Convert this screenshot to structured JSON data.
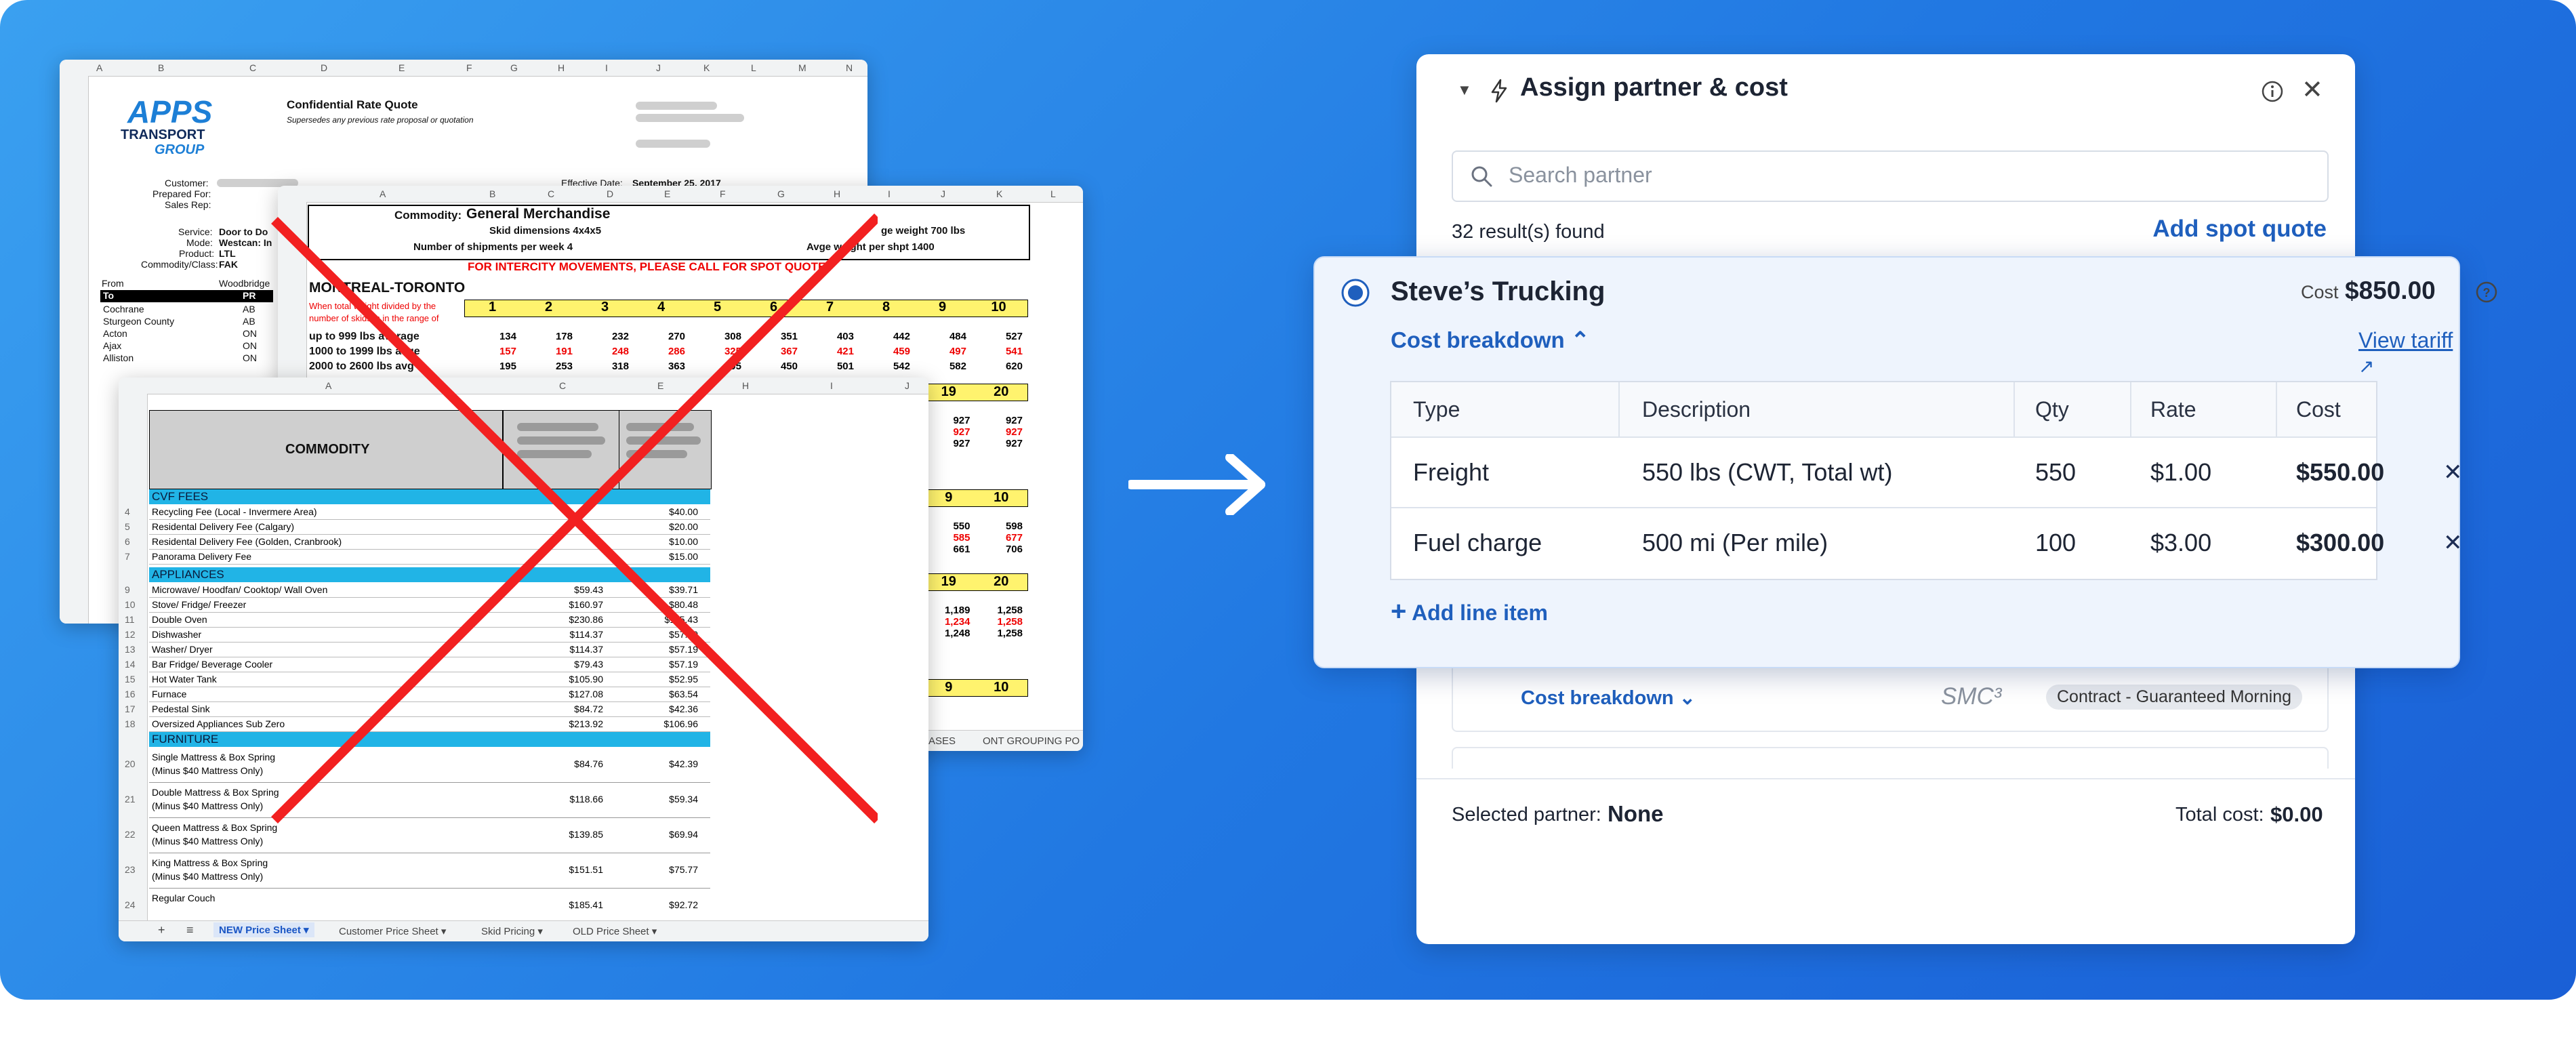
{
  "colors": {
    "accent": "#1f5fbd",
    "bg_blue": "#2178e2",
    "red_x": "#f22020"
  },
  "back_sheet": {
    "columns": [
      "A",
      "B",
      "C",
      "D",
      "E",
      "F",
      "G",
      "H",
      "I",
      "J",
      "K",
      "L",
      "M",
      "N"
    ],
    "logo": [
      "APPS",
      "TRANSPORT",
      "GROUP"
    ],
    "title": "Confidential Rate Quote",
    "subtitle": "Supersedes any previous rate proposal or quotation",
    "labels": [
      "Customer:",
      "Prepared For:",
      "Sales Rep:",
      "Service:",
      "Mode:",
      "Product:",
      "Commodity/Class:",
      "From"
    ],
    "values": [
      "Door to Do",
      "Westcan: In",
      "LTL",
      "FAK",
      "Woodbridge"
    ],
    "effective_label": "Effective Date:",
    "effective_value": "September 25, 2017",
    "to_header": "To",
    "pr_header": "PR",
    "cities": [
      "Cochrane",
      "Sturgeon County",
      "Acton",
      "Ajax",
      "Alliston"
    ],
    "provs": [
      "AB",
      "AB",
      "ON",
      "ON",
      "ON"
    ]
  },
  "mid_sheet": {
    "columns": [
      "A",
      "B",
      "C",
      "D",
      "E",
      "F",
      "G",
      "H",
      "I",
      "J",
      "K",
      "L"
    ],
    "commodity": "Commodity:",
    "commodity_value": "General Merchandise",
    "skid_dim": "Skid dimensions  4x4x5",
    "shipments": "Number of shipments per week        4",
    "avg_weight": "ge weight    700 lbs",
    "avg_weight_shpt": "Avge weight per shpt         1400",
    "notice": "FOR INTERCITY MOVEMENTS, PLEASE CALL FOR SPOT QUOTE",
    "route": "MONTREAL-TORONTO",
    "note": [
      "When total weight divided by the",
      "number of skids is in the range of"
    ],
    "skid_counts": [
      "1",
      "2",
      "3",
      "4",
      "5",
      "6",
      "7",
      "8",
      "9",
      "10"
    ],
    "row_labels": [
      "up to 999 lbs average",
      "1000 to 1999 lbs avge",
      "2000 to 2600 lbs avg"
    ],
    "row1": [
      "134",
      "178",
      "232",
      "270",
      "308",
      "351",
      "403",
      "442",
      "484",
      "527"
    ],
    "row2": [
      "157",
      "191",
      "248",
      "286",
      "325",
      "367",
      "421",
      "459",
      "497",
      "541"
    ],
    "row3": [
      "195",
      "253",
      "318",
      "363",
      "405",
      "450",
      "501",
      "542",
      "582",
      "620"
    ],
    "right_headers": [
      "19",
      "20",
      "9",
      "10",
      "19",
      "20",
      "9",
      "10"
    ],
    "right_vals": [
      "927",
      "927",
      "927",
      "550",
      "598",
      "585",
      "677",
      "661",
      "706",
      "1,189",
      "1,258",
      "1,234",
      "1,258",
      "1,248",
      "1,258"
    ],
    "tabs": [
      "ASES",
      "ONT GROUPING PO"
    ]
  },
  "front_sheet": {
    "columns": [
      "A",
      "C",
      "E",
      "H",
      "I",
      "J"
    ],
    "header": "COMMODITY",
    "sections": [
      "CVF FEES",
      "APPLIANCES",
      "FURNITURE"
    ],
    "items": [
      {
        "n": "4",
        "name": "Recycling Fee (Local - Invermere Area)",
        "c": "",
        "e": "$40.00"
      },
      {
        "n": "5",
        "name": "Residental Delivery Fee (Calgary)",
        "c": "",
        "e": "$20.00"
      },
      {
        "n": "6",
        "name": "Residental Delivery Fee (Golden, Cranbrook)",
        "c": "",
        "e": "$10.00"
      },
      {
        "n": "7",
        "name": "Panorama Delivery Fee",
        "c": "",
        "e": "$15.00"
      },
      {
        "n": "9",
        "name": "Microwave/ Hoodfan/ Cooktop/ Wall Oven",
        "c": "$59.43",
        "e": "$39.71"
      },
      {
        "n": "10",
        "name": "Stove/ Fridge/ Freezer",
        "c": "$160.97",
        "e": "$80.48"
      },
      {
        "n": "11",
        "name": "Double Oven",
        "c": "$230.86",
        "e": "$115.43"
      },
      {
        "n": "12",
        "name": "Dishwasher",
        "c": "$114.37",
        "e": "$57.19"
      },
      {
        "n": "13",
        "name": "Washer/ Dryer",
        "c": "$114.37",
        "e": "$57.19"
      },
      {
        "n": "14",
        "name": "Bar Fridge/ Beverage Cooler",
        "c": "$79.43",
        "e": "$57.19"
      },
      {
        "n": "15",
        "name": "Hot Water Tank",
        "c": "$105.90",
        "e": "$52.95"
      },
      {
        "n": "16",
        "name": "Furnace",
        "c": "$127.08",
        "e": "$63.54"
      },
      {
        "n": "17",
        "name": "Pedestal Sink",
        "c": "$84.72",
        "e": "$42.36"
      },
      {
        "n": "18",
        "name": "Oversized Appliances Sub Zero",
        "c": "$213.92",
        "e": "$106.96"
      }
    ],
    "furniture": [
      {
        "n": "20",
        "l1": "Single Mattress & Box Spring",
        "l2": "(Minus $40 Mattress Only)",
        "c": "$84.76",
        "e": "$42.39"
      },
      {
        "n": "21",
        "l1": "Double Mattress & Box Spring",
        "l2": "(Minus $40 Mattress Only)",
        "c": "$118.66",
        "e": "$59.34"
      },
      {
        "n": "22",
        "l1": "Queen Mattress & Box Spring",
        "l2": "(Minus $40 Mattress Only)",
        "c": "$139.85",
        "e": "$69.94"
      },
      {
        "n": "23",
        "l1": "King Mattress & Box Spring",
        "l2": "(Minus $40 Mattress Only)",
        "c": "$151.51",
        "e": "$75.77"
      },
      {
        "n": "24",
        "l1": "Regular Couch",
        "l2": "",
        "c": "$185.41",
        "e": "$92.72"
      }
    ],
    "tabs": [
      "NEW Price Sheet",
      "Customer Price Sheet",
      "Skid Pricing",
      "OLD Price Sheet"
    ]
  },
  "panel": {
    "title": "Assign partner & cost",
    "search_placeholder": "Search partner",
    "results": "32 result(s) found",
    "add_spot_quote": "Add spot quote",
    "cost_breakdown_2": "Cost breakdown",
    "smc_logo": "SMC³",
    "contract_badge": "Contract - Guaranteed Morning",
    "selected_label": "Selected partner:",
    "selected_value": "None",
    "total_label": "Total cost:",
    "total_value": "$0.00"
  },
  "card": {
    "partner": "Steve’s Trucking",
    "cost_label": "Cost",
    "cost_value": "$850.00",
    "cost_breakdown": "Cost breakdown",
    "view_tariff": "View tariff",
    "headers": [
      "Type",
      "Description",
      "Qty",
      "Rate",
      "Cost"
    ],
    "rows": [
      {
        "type": "Freight",
        "desc": "550 lbs (CWT, Total wt)",
        "qty": "550",
        "rate": "$1.00",
        "cost": "$550.00"
      },
      {
        "type": "Fuel charge",
        "desc": "500 mi (Per mile)",
        "qty": "100",
        "rate": "$3.00",
        "cost": "$300.00"
      }
    ],
    "add_line": "Add line item"
  }
}
